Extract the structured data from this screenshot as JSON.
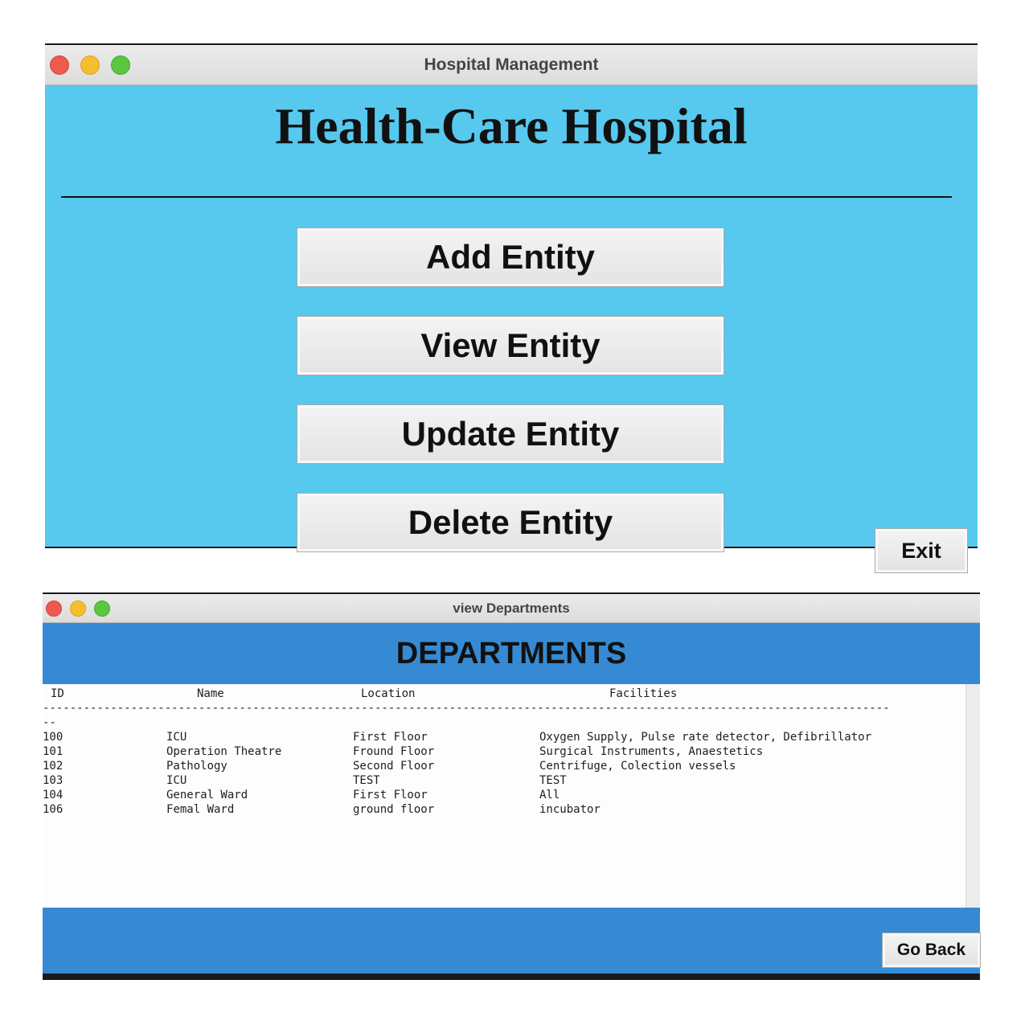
{
  "main_window": {
    "title": "Hospital Management",
    "heading": "Health-Care Hospital",
    "buttons": {
      "add": "Add Entity",
      "view": "View Entity",
      "update": "Update Entity",
      "delete": "Delete Entity",
      "exit": "Exit"
    },
    "colors": {
      "background": "#57c8ee"
    }
  },
  "departments_window": {
    "title": "view Departments",
    "banner": "DEPARTMENTS",
    "columns": [
      "ID",
      "Name",
      "Location",
      "Facilities"
    ],
    "separator": "-----------------------------------------------------------------------------------------------------------------------------",
    "separator_tail": "--",
    "rows": [
      {
        "id": "100",
        "name": "ICU",
        "location": "First Floor",
        "facilities": "Oxygen Supply, Pulse rate detector, Defibrillator"
      },
      {
        "id": "101",
        "name": "Operation Theatre",
        "location": "Fround Floor",
        "facilities": "Surgical Instruments, Anaestetics"
      },
      {
        "id": "102",
        "name": "Pathology",
        "location": "Second Floor",
        "facilities": "Centrifuge, Colection vessels"
      },
      {
        "id": "103",
        "name": "ICU",
        "location": "TEST",
        "facilities": "TEST"
      },
      {
        "id": "104",
        "name": "General Ward",
        "location": "First Floor",
        "facilities": "All"
      },
      {
        "id": "106",
        "name": "Femal Ward",
        "location": "ground floor",
        "facilities": "incubator"
      }
    ],
    "go_back": "Go Back",
    "colors": {
      "banner": "#358ad3"
    }
  },
  "traffic_lights": [
    "close-icon",
    "minimize-icon",
    "zoom-icon"
  ]
}
